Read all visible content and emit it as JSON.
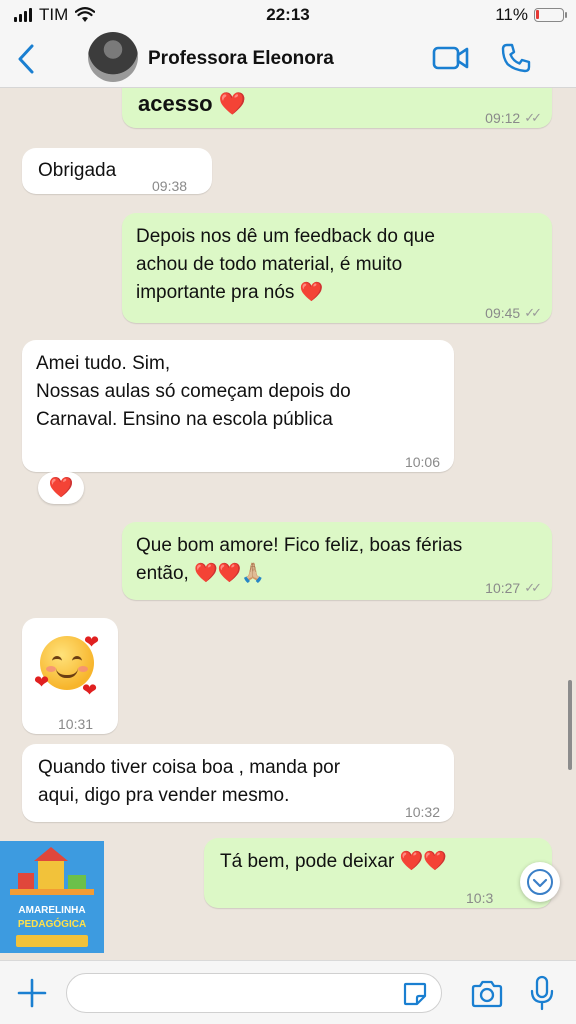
{
  "status": {
    "carrier": "TIM",
    "time": "22:13",
    "battery": "11%",
    "battery_level": 0.11
  },
  "header": {
    "contact_name": "Professora Eleonora"
  },
  "messages": [
    {
      "dir": "out",
      "text": "acesso",
      "heart": "❤️",
      "time": "09:12"
    },
    {
      "dir": "in",
      "text": "Obrigada",
      "time": "09:38"
    },
    {
      "dir": "out",
      "text": "Depois nos dê um feedback do que\nachou de todo material, é muito\nimportante pra nós",
      "heart": "❤️",
      "time": "09:45"
    },
    {
      "dir": "in",
      "text": "Amei tudo. Sim,\nNossas aulas só começam  depois do\nCarnaval. Ensino na escola pública",
      "time": "10:06",
      "reaction": "❤️"
    },
    {
      "dir": "out",
      "text": "Que bom amore! Fico feliz, boas férias\nentão,",
      "hearts": "❤️❤️🙏🏼",
      "time": "10:27"
    },
    {
      "dir": "in",
      "emoji": "🥰",
      "time": "10:31"
    },
    {
      "dir": "in",
      "text": "Quando tiver coisa boa , manda por\naqui, digo pra vender mesmo.",
      "time": "10:32"
    },
    {
      "dir": "out",
      "text": "Tá bem, pode deixar",
      "hearts": "❤️❤️",
      "time": "10:3"
    }
  ],
  "thumbnail": {
    "title_line1": "AMARELINHA",
    "title_line2": "PEDAGÓGICA"
  },
  "colors": {
    "outgoing_bubble": "#dcf8c6",
    "incoming_bubble": "#ffffff",
    "chat_background": "#ece5dd",
    "accent": "#1a7fd1",
    "heart": "#e02020"
  },
  "icons": [
    "back-chevron-icon",
    "video-call-icon",
    "phone-icon",
    "plus-icon",
    "sticker-icon",
    "camera-icon",
    "microphone-icon",
    "chevron-down-icon",
    "wifi-icon",
    "signal-icon",
    "battery-icon"
  ],
  "input": {
    "placeholder": ""
  }
}
